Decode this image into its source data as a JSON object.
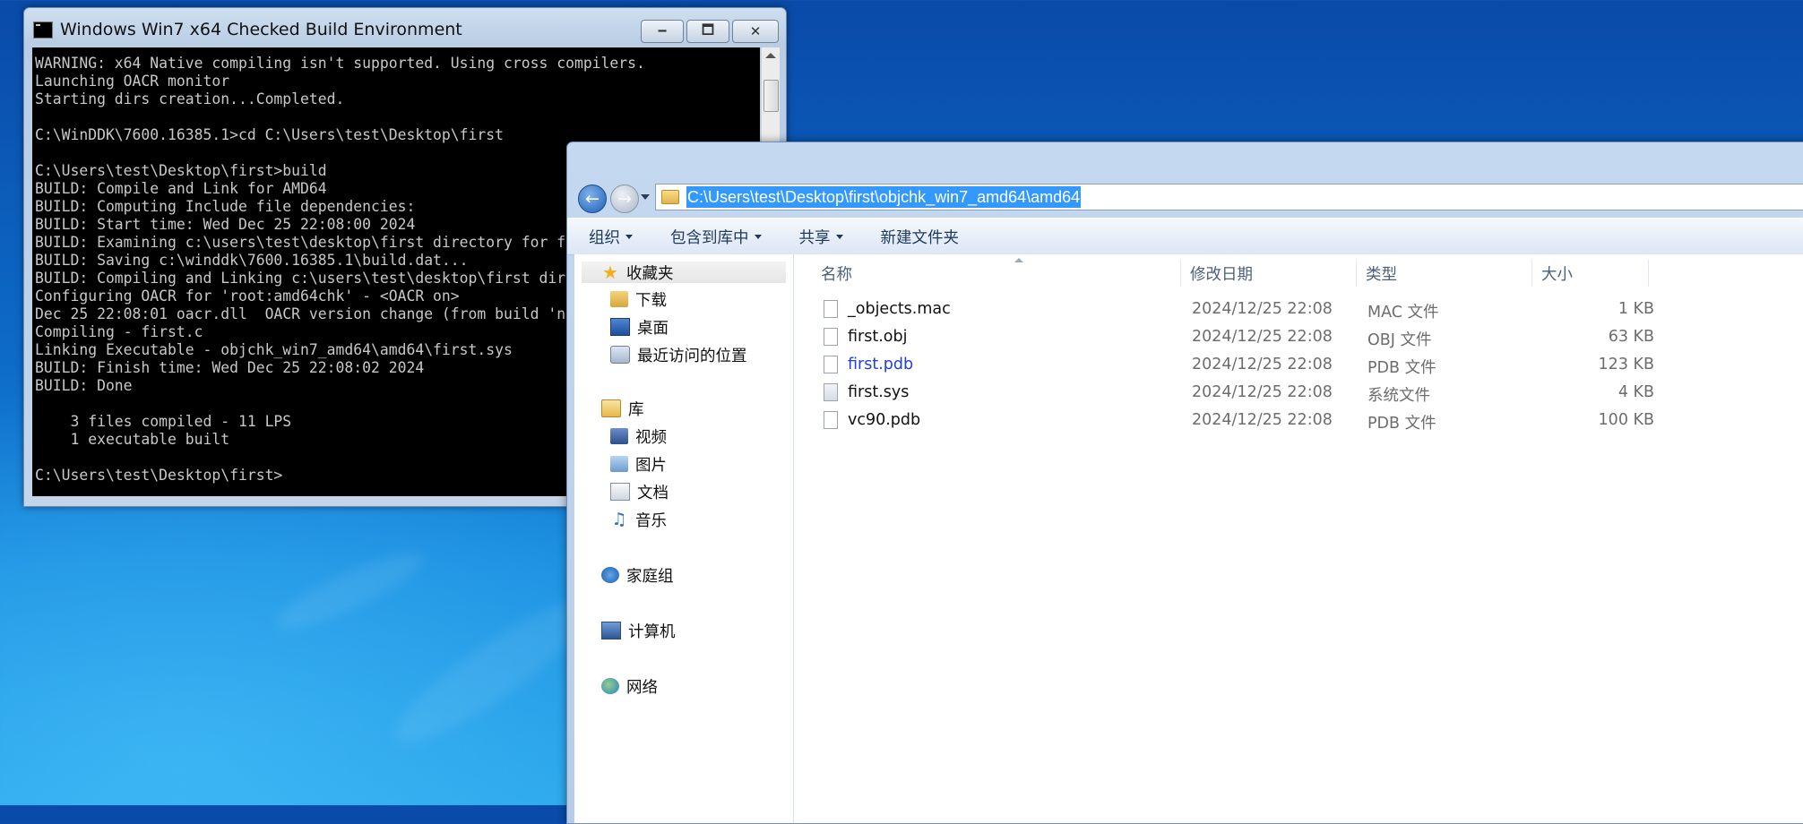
{
  "console": {
    "title": "Windows Win7 x64 Checked Build Environment",
    "min_label": "🗕",
    "max_label": "🗖",
    "close_label": "✕",
    "lines": [
      "WARNING: x64 Native compiling isn't supported. Using cross compilers.",
      "Launching OACR monitor",
      "Starting dirs creation...Completed.",
      "",
      "C:\\WinDDK\\7600.16385.1>cd C:\\Users\\test\\Desktop\\first",
      "",
      "C:\\Users\\test\\Desktop\\first>build",
      "BUILD: Compile and Link for AMD64",
      "BUILD: Computing Include file dependencies:",
      "BUILD: Start time: Wed Dec 25 22:08:00 2024",
      "BUILD: Examining c:\\users\\test\\desktop\\first directory for f",
      "BUILD: Saving c:\\winddk\\7600.16385.1\\build.dat...",
      "BUILD: Compiling and Linking c:\\users\\test\\desktop\\first dir",
      "Configuring OACR for 'root:amd64chk' - <OACR on>",
      "Dec 25 22:08:01 oacr.dll  OACR version change (from build 'n",
      "Compiling - first.c",
      "Linking Executable - objchk_win7_amd64\\amd64\\first.sys",
      "BUILD: Finish time: Wed Dec 25 22:08:02 2024",
      "BUILD: Done",
      "",
      "    3 files compiled - 11 LPS",
      "    1 executable built",
      "",
      "C:\\Users\\test\\Desktop\\first>"
    ]
  },
  "explorer": {
    "address": "C:\\Users\\test\\Desktop\\first\\objchk_win7_amd64\\amd64",
    "toolbar": {
      "organize": "组织",
      "include_library": "包含到库中",
      "share": "共享",
      "new_folder": "新建文件夹"
    },
    "nav": {
      "favorites": "收藏夹",
      "downloads": "下载",
      "desktop": "桌面",
      "recent": "最近访问的位置",
      "libraries": "库",
      "videos": "视频",
      "pictures": "图片",
      "documents": "文档",
      "music": "音乐",
      "homegroup": "家庭组",
      "computer": "计算机",
      "network": "网络"
    },
    "columns": {
      "name": "名称",
      "date": "修改日期",
      "type": "类型",
      "size": "大小"
    },
    "files": [
      {
        "name": "_objects.mac",
        "date": "2024/12/25 22:08",
        "type": "MAC 文件",
        "size": "1 KB"
      },
      {
        "name": "first.obj",
        "date": "2024/12/25 22:08",
        "type": "OBJ 文件",
        "size": "63 KB"
      },
      {
        "name": "first.pdb",
        "date": "2024/12/25 22:08",
        "type": "PDB 文件",
        "size": "123 KB"
      },
      {
        "name": "first.sys",
        "date": "2024/12/25 22:08",
        "type": "系统文件",
        "size": "4 KB"
      },
      {
        "name": "vc90.pdb",
        "date": "2024/12/25 22:08",
        "type": "PDB 文件",
        "size": "100 KB"
      }
    ]
  }
}
